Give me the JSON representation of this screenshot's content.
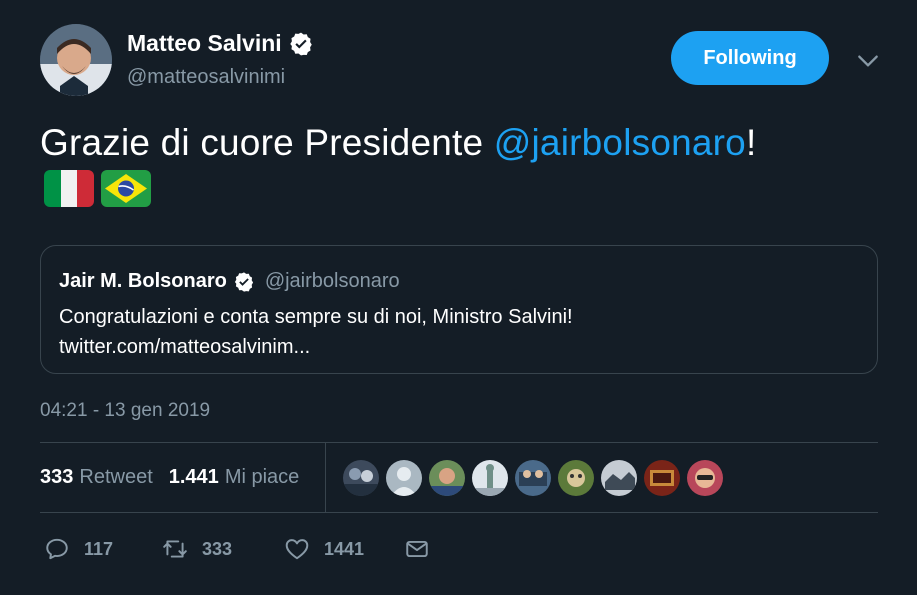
{
  "author": {
    "name": "Matteo Salvini",
    "handle": "@matteosalvinimi",
    "verified": true
  },
  "follow_button": {
    "label": "Following"
  },
  "tweet": {
    "text_prefix": "Grazie di cuore Presidente ",
    "mention": "@jairbolsonaro",
    "text_suffix": "!",
    "emojis": [
      "flag-italy",
      "flag-brazil"
    ]
  },
  "quoted_tweet": {
    "name": "Jair M. Bolsonaro",
    "handle": "@jairbolsonaro",
    "verified": true,
    "text": "Congratulazioni e conta sempre su di noi, Ministro Salvini!",
    "link": "twitter.com/matteosalvinim..."
  },
  "timestamp": "04:21 - 13 gen 2019",
  "stats": {
    "retweets_count": "333",
    "retweets_label": "Retweet",
    "likes_count": "1.441",
    "likes_label": "Mi piace"
  },
  "likers_count_shown": 9,
  "actions": {
    "replies": "117",
    "retweets": "333",
    "likes": "1441"
  },
  "colors": {
    "background": "#141d26",
    "accent": "#1da1f2",
    "muted": "#8899a6",
    "border": "#38444d"
  }
}
